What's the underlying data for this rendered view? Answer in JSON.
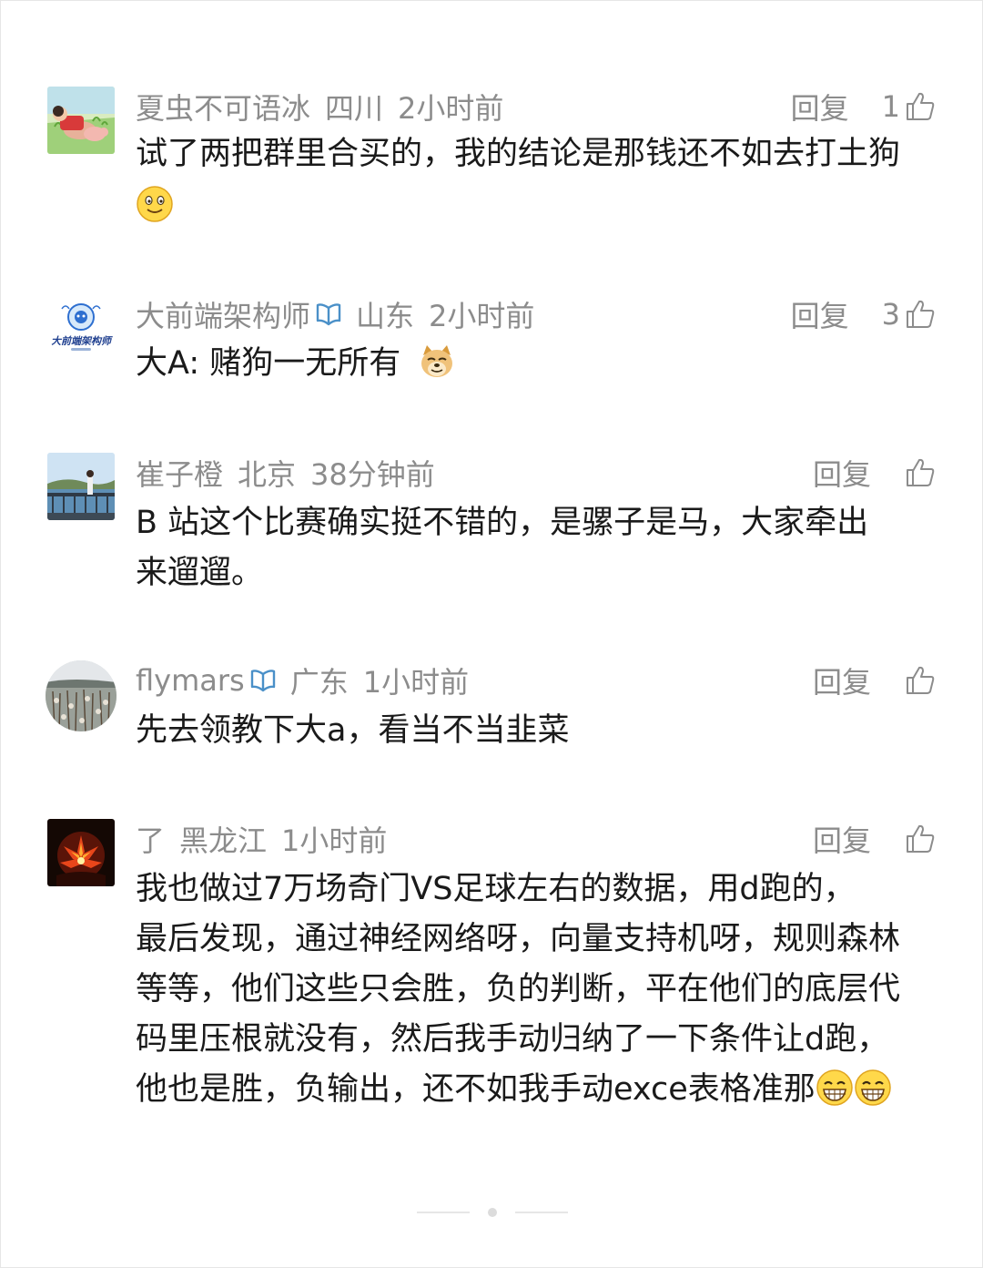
{
  "comments": [
    {
      "username": "夏虫不可语冰",
      "location": "四川",
      "time": "2小时前",
      "verified": false,
      "reply_label": "回复",
      "likes": "1",
      "text": "试了两把群里合买的，我的结论是那钱还不如去打土狗",
      "emoji": "smile-emoji"
    },
    {
      "username": "大前端架构师",
      "location": "山东",
      "time": "2小时前",
      "verified": true,
      "reply_label": "回复",
      "likes": "3",
      "text": "大A: 赌狗一无所有",
      "emoji": "doge-emoji"
    },
    {
      "username": "崔子橙",
      "location": "北京",
      "time": "38分钟前",
      "verified": false,
      "reply_label": "回复",
      "likes": "",
      "text_lines": [
        "B 站这个比赛确实挺不错的，是骡子是马，大家牵出",
        "来遛遛。"
      ]
    },
    {
      "username": "flymars",
      "location": "广东",
      "time": "1小时前",
      "verified": true,
      "reply_label": "回复",
      "likes": "",
      "text": "先去领教下大a，看当不当韭菜"
    },
    {
      "username": "了",
      "location": "黑龙江",
      "time": "1小时前",
      "verified": false,
      "reply_label": "回复",
      "likes": "",
      "text_lines": [
        "我也做过7万场奇门VS足球左右的数据，用d跑的，",
        "最后发现，通过神经网络呀，向量支持机呀，规则森林",
        "等等，他们这些只会胜，负的判断，平在他们的底层代",
        "码里压根就没有，然后我手动归纳了一下条件让d跑，",
        "他也是胜，负输出，还不如我手动exce表格准那"
      ],
      "emoji": "grin-emoji"
    }
  ],
  "avatar_logo_text": "大前端架构师",
  "colors": {
    "meta": "#8c8c8c",
    "text": "#1a1a1a",
    "verified": "#4a90c8",
    "background": "#ffffff"
  }
}
